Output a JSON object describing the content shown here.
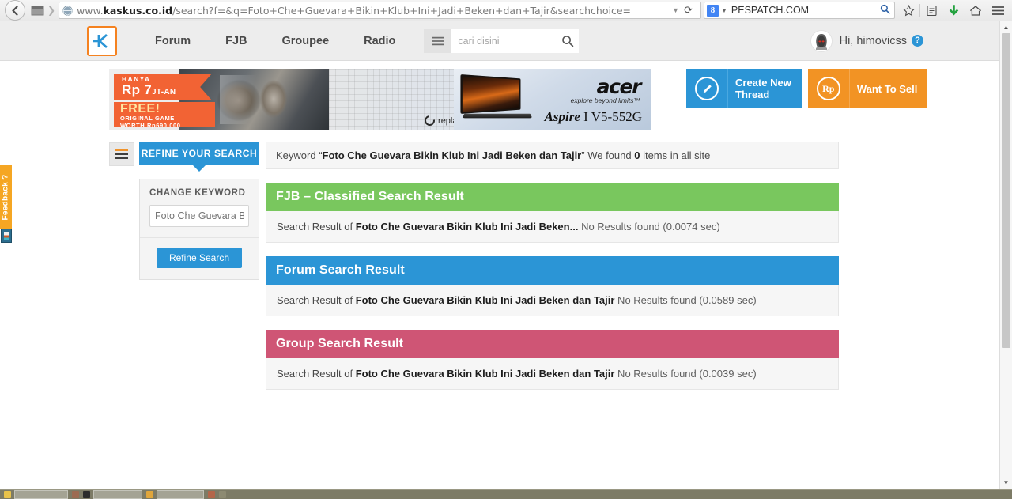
{
  "browser": {
    "back_icon": "back-arrow-icon",
    "tab_icon": "tab-list-icon",
    "url_prefix": "www.",
    "url_domain": "kaskus.co.id",
    "url_path": "/search?f=&q=Foto+Che+Guevara+Bikin+Klub+Ini+Jadi+Beken+dan+Tajir&searchchoice=",
    "url_dropdown_icon": "▼",
    "reload_icon": "⟳",
    "search_engine_letter": "8",
    "search_value": "PESPATCH.COM",
    "search_caret": "▼",
    "magnifier_icon": "search-icon",
    "bookmark_icon": "★",
    "reader_icon": "reader-view-icon",
    "download_icon": "download-arrow-icon",
    "home_icon": "home-icon",
    "menu_icon": "hamburger-menu-icon"
  },
  "site_header": {
    "logo_text": "K",
    "nav": [
      {
        "label": "Forum"
      },
      {
        "label": "FJB"
      },
      {
        "label": "Groupee"
      },
      {
        "label": "Radio"
      }
    ],
    "search_placeholder": "cari disini",
    "search_hamburger_icon": "category-menu-icon",
    "search_icon": "search-icon",
    "user_greeting": "Hi, himovicss",
    "help_badge": "?",
    "avatar_icon": "user-avatar-hooded-figure"
  },
  "ads": {
    "banner": {
      "ribbon_top": "HANYA",
      "ribbon_price": "Rp 7",
      "ribbon_price_suffix": "JT-AN",
      "free_title": "FREE!",
      "free_line1": "ORIGINAL GAME",
      "free_line2": "WORTH Rp690.000",
      "replay_label": "replay"
    },
    "acer": {
      "brand": "acer",
      "tagline": "explore beyond limits™",
      "model_prefix": "Aspire",
      "model_suffix": " I V5-552G"
    }
  },
  "cta": {
    "create_thread": {
      "label": "Create New\nThread",
      "label_line1": "Create New",
      "label_line2": "Thread",
      "icon": "pencil-circle-icon",
      "color": "#2b95d6"
    },
    "want_to_sell": {
      "label": "Want To Sell",
      "icon": "rupiah-circle-icon",
      "icon_text": "Rp",
      "color": "#f29324"
    }
  },
  "sidebar": {
    "toggle_icon": "filter-menu-icon",
    "tab_label": "REFINE YOUR SEARCH",
    "change_keyword_label": "CHANGE KEYWORD",
    "keyword_input_value": "Foto Che Guevara Bi",
    "keyword_input_placeholder": "Foto Che Guevara Bi",
    "refine_button_label": "Refine Search"
  },
  "results": {
    "keyword_prefix": "Keyword “",
    "keyword_value": "Foto Che Guevara Bikin Klub Ini Jadi Beken dan Tajir",
    "keyword_mid": "” We found ",
    "keyword_count": "0",
    "keyword_suffix": " items in all site",
    "blocks": [
      {
        "title": "FJB – Classified Search Result",
        "color": "#79c75e",
        "body_prefix": "Search Result of ",
        "body_keyword": "Foto Che Guevara Bikin Klub Ini Jadi Beken...",
        "body_status": " No Results found (0.0074 sec)"
      },
      {
        "title": "Forum Search Result",
        "color": "#2b95d6",
        "body_prefix": "Search Result of ",
        "body_keyword": "Foto Che Guevara Bikin Klub Ini Jadi Beken dan Tajir",
        "body_status": " No Results found (0.0589 sec)"
      },
      {
        "title": "Group Search Result",
        "color": "#cf5575",
        "body_prefix": "Search Result of ",
        "body_keyword": "Foto Che Guevara Bikin Klub Ini Jadi Beken dan Tajir",
        "body_status": " No Results found (0.0039 sec)"
      }
    ]
  },
  "feedback": {
    "label": "Feedback ?",
    "icon": "feedback-bottle-icon"
  },
  "scrollbar": {
    "up_arrow": "▲",
    "down_arrow": "▼"
  }
}
